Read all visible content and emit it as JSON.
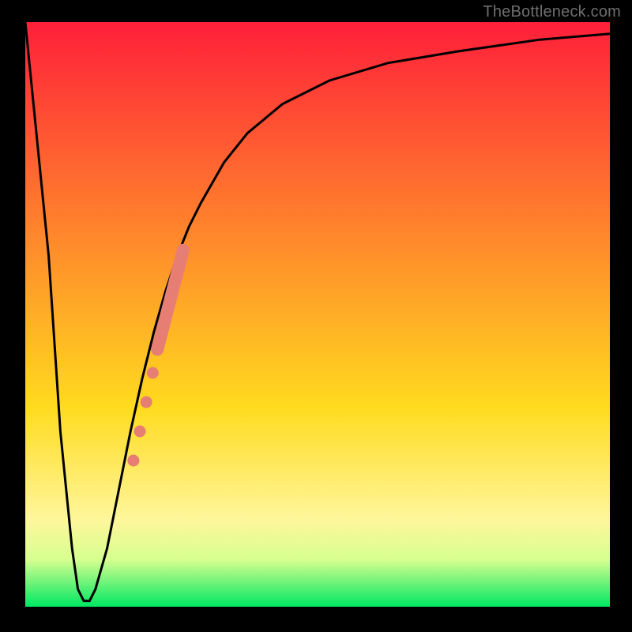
{
  "watermark": "TheBottleneck.com",
  "colors": {
    "frame": "#000000",
    "curve": "#000000",
    "marker_fill": "#e77e74",
    "marker_stroke": "#e77e74",
    "gradient_top": "#ff1f3a",
    "gradient_mid_upper": "#ff8b2b",
    "gradient_mid": "#ffdb1f",
    "gradient_lower": "#fff69b",
    "gradient_band": "#d6ff8f",
    "gradient_bottom": "#00e763"
  },
  "chart_data": {
    "type": "line",
    "title": "",
    "xlabel": "",
    "ylabel": "",
    "xlim": [
      0,
      100
    ],
    "ylim": [
      0,
      100
    ],
    "grid": false,
    "series": [
      {
        "name": "bottleneck-curve",
        "x": [
          0,
          4,
          6,
          8,
          9,
          10,
          11,
          12,
          14,
          16,
          18,
          20,
          22,
          24,
          26,
          28,
          30,
          34,
          38,
          44,
          52,
          62,
          74,
          88,
          100
        ],
        "y": [
          100,
          60,
          30,
          10,
          3,
          1,
          1,
          3,
          10,
          20,
          30,
          39,
          47,
          54,
          60,
          65,
          69,
          76,
          81,
          86,
          90,
          93,
          95,
          97,
          98
        ]
      }
    ],
    "markers": {
      "name": "highlight-points",
      "points": [
        {
          "x": 18.5,
          "y": 25.0
        },
        {
          "x": 19.6,
          "y": 30.0
        },
        {
          "x": 20.7,
          "y": 35.0
        },
        {
          "x": 21.8,
          "y": 40.0
        }
      ],
      "thick_segment": {
        "x0": 22.6,
        "y0": 44.0,
        "x1": 27.0,
        "y1": 61.0
      }
    }
  }
}
